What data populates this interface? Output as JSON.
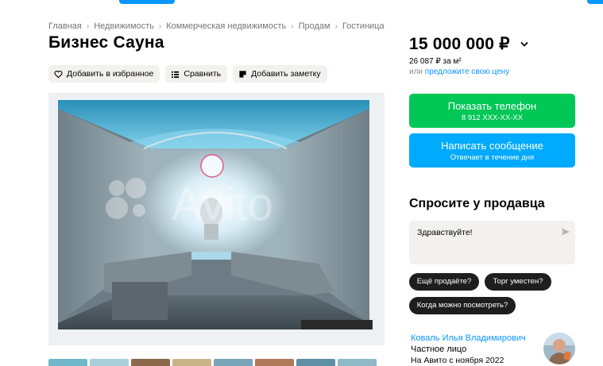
{
  "breadcrumb": [
    "Главная",
    "Недвижимость",
    "Коммерческая недвижимость",
    "Продам",
    "Гостиница"
  ],
  "listing": {
    "title": "Бизнес Сауна",
    "favorite_label": "Добавить в избранное",
    "compare_label": "Сравнить",
    "note_label": "Добавить заметку"
  },
  "gallery": {
    "watermark": "Avito"
  },
  "price": {
    "value": "15 000 000 ₽",
    "per_m": "26 087 ₽ за м²",
    "offer_prefix": "или ",
    "offer_link": "предложите свою цену"
  },
  "contact": {
    "phone_label": "Показать телефон",
    "phone_number": "8 912 XXX-XX-XX",
    "message_label": "Написать сообщение",
    "message_sub": "Отвечает в течение дня"
  },
  "ask": {
    "title": "Спросите у продавца",
    "message": "Здравствуйте!",
    "chips": [
      "Ещё продаёте?",
      "Торг уместен?",
      "Когда можно посмотреть?"
    ]
  },
  "seller": {
    "name": "Коваль Илья Владимирович",
    "type": "Частное лицо",
    "since": "На Авито с ноября 2022"
  },
  "colors": {
    "green": "#00c756",
    "blue": "#00aaff",
    "link": "#0a96ff",
    "chip": "#1e1e1e"
  }
}
